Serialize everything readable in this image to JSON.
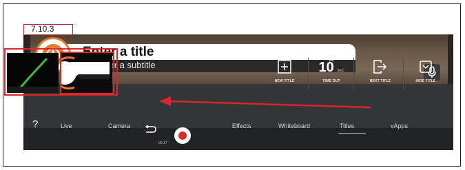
{
  "step": {
    "label": "7.10.3"
  },
  "preview": {
    "title": "Enter a title",
    "subtitle": "Enter a subtitle",
    "logo_icon": "compass-icon",
    "mic_icon": "microphone-icon"
  },
  "toolbar": {
    "new_title": "NEW TITLE",
    "timeout_value": "10",
    "timeout_unit": "SEC",
    "timeout_label": "TIME OUT",
    "next_title": "NEXT TITLE",
    "hide_title": "HIDE TITLE"
  },
  "nav": {
    "help": "?",
    "live": "Live",
    "camera": "Camera",
    "timer": "00:17",
    "effects": "Effects",
    "whiteboard": "Whiteboard",
    "titles": "Titles",
    "vapps": "vApps"
  },
  "colors": {
    "highlight": "#d8262b",
    "accent_orange": "#e87a2c",
    "record_red": "#e02a2a",
    "thumbnail_green": "#3fbf3f"
  }
}
